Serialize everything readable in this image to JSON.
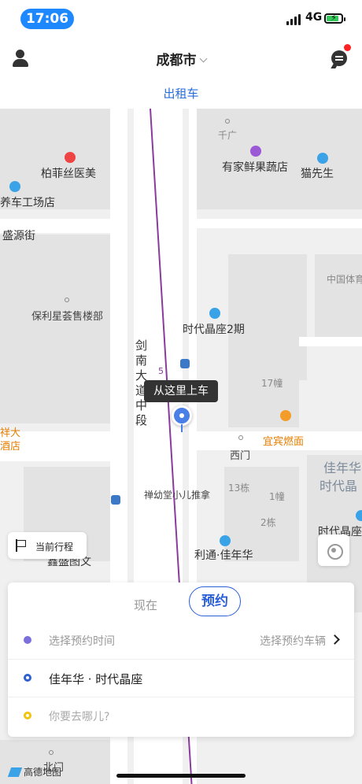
{
  "status_bar": {
    "time": "17:06",
    "network": "4G",
    "battery_level": 0.85
  },
  "header": {
    "city": "成都市",
    "service_tab": "出租车"
  },
  "map": {
    "labels": {
      "qiguang": "千广",
      "youjia": "有家鲜果蔬店",
      "baifeisi": "柏菲丝医美",
      "yangche": "养车工场店",
      "maoxiansheng": "猫先生",
      "shengyuan": "盛源街",
      "zhongguoti": "中国体育",
      "baoli": "保利星荟售楼部",
      "shidai2": "时代晶座2期",
      "jiannan": "剑南大道中段",
      "route_no": "5",
      "b17": "17幢",
      "yibin": "宜宾燃面",
      "ximen": "西门",
      "jianian_right": "佳年华",
      "shidaijing_right": "时代晶",
      "dadian": "祥大\n酒店",
      "chanyou": "禅幼堂小儿推拿",
      "b13": "13栋",
      "b1": "1幢",
      "b2": "2栋",
      "shidaijingzuo": "时代晶座",
      "litong": "利通·佳年华",
      "jinjiaotuwen": "鑫盛图文",
      "beimen": "北门"
    },
    "pickup_label": "从这里上车",
    "trip_button": "当前行程",
    "logo_text": "高德地图"
  },
  "booking": {
    "mode_now": "现在",
    "mode_book": "预约",
    "time_placeholder": "选择预约时间",
    "vehicle_placeholder": "选择预约车辆",
    "from": "佳年华 · 时代晶座",
    "to_placeholder": "你要去哪儿?"
  },
  "colors": {
    "accent": "#2a5fd8",
    "status_pill": "#1e88ff",
    "metro_line": "#8b3a9e"
  },
  "icons": [
    "user-icon",
    "message-icon",
    "flag-icon",
    "locate-icon",
    "chevron-right-icon",
    "bus-stop-icon"
  ]
}
